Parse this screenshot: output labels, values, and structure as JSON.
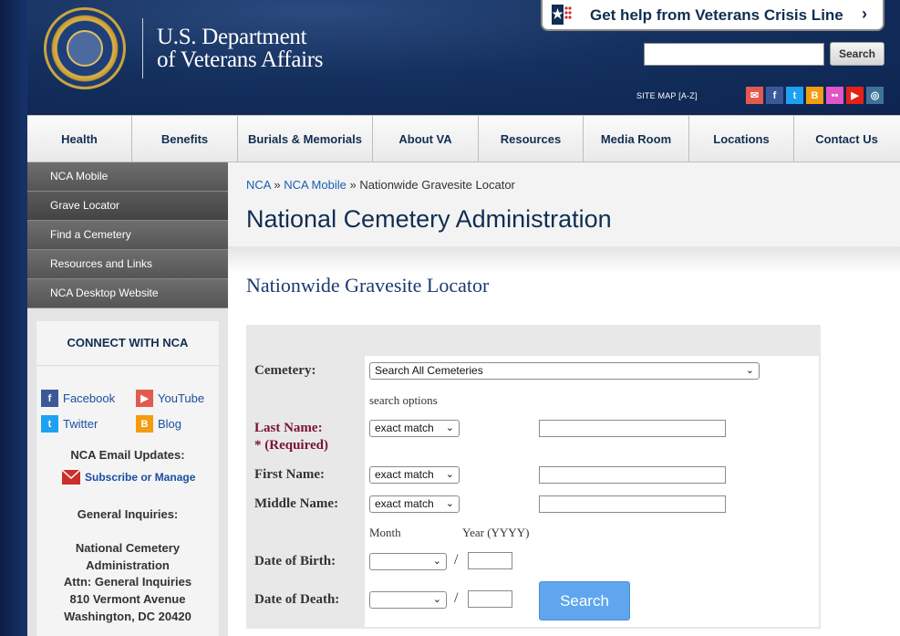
{
  "header": {
    "dept_line1": "U.S. Department",
    "dept_line2": "of Veterans Affairs",
    "crisis_label": "Get help from Veterans Crisis Line",
    "search_button": "Search",
    "search_value": "",
    "sitemap_label": "SITE MAP [A-Z]",
    "social_icons": [
      "email-icon",
      "facebook-icon",
      "twitter-icon",
      "blogger-icon",
      "flickr-icon",
      "youtube-icon",
      "instagram-icon"
    ]
  },
  "nav": {
    "items": [
      "Health",
      "Benefits",
      "Burials & Memorials",
      "About VA",
      "Resources",
      "Media Room",
      "Locations",
      "Contact Us"
    ]
  },
  "sidebar": {
    "items": [
      "NCA Mobile",
      "Grave Locator",
      "Find a Cemetery",
      "Resources and Links",
      "NCA Desktop Website"
    ],
    "connect_title": "CONNECT WITH NCA",
    "facebook": "Facebook",
    "youtube": "YouTube",
    "twitter": "Twitter",
    "blog": "Blog",
    "email_updates": "NCA Email Updates:",
    "subscribe": "Subscribe or Manage",
    "general_inquiries": "General Inquiries:",
    "address_line1": "National Cemetery",
    "address_line2": "Administration",
    "address_line3": "Attn: General Inquiries",
    "address_line4": "810 Vermont Avenue",
    "address_line5": "Washington, DC 20420"
  },
  "breadcrumb": {
    "nca": "NCA",
    "sep": "»",
    "mobile": "NCA Mobile",
    "current": "Nationwide Gravesite Locator"
  },
  "main": {
    "title": "National Cemetery Administration",
    "subtitle": "Nationwide Gravesite Locator"
  },
  "form": {
    "cemetery_label": "Cemetery:",
    "cemetery_value": "Search All Cemeteries",
    "search_options": "search options",
    "last_name_label": "Last Name:",
    "required_label": "* (Required)",
    "first_name_label": "First Name:",
    "middle_name_label": "Middle Name:",
    "match_option": "exact match",
    "month_label": "Month",
    "year_label": "Year (YYYY)",
    "dob_label": "Date of Birth:",
    "dod_label": "Date of Death:",
    "slash": "/",
    "search_button": "Search"
  },
  "colors": {
    "header_blue": "#14305e",
    "link_blue": "#1a5fb4",
    "title_navy": "#112e51",
    "required_maroon": "#7a1234",
    "button_blue": "#5fa6ef"
  }
}
